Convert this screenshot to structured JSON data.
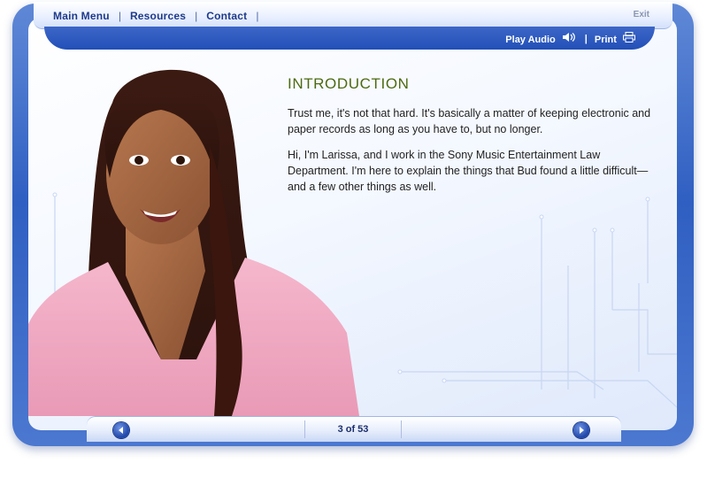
{
  "nav": {
    "main_menu": "Main Menu",
    "resources": "Resources",
    "contact": "Contact",
    "sep": "|",
    "exit": "Exit"
  },
  "tools": {
    "play_audio": "Play Audio",
    "print": "Print",
    "sep": "|"
  },
  "content": {
    "heading": "INTRODUCTION",
    "paragraphs": [
      "Trust me, it's not that hard. It's basically a matter of keeping electronic and paper records as long as you have to, but no longer.",
      "Hi, I'm Larissa, and I work in the Sony Music Entertainment Law Department. I'm here to explain the things that Bud found a little difficult—and a few other things as well."
    ]
  },
  "pager": {
    "text": "3 of 53"
  },
  "colors": {
    "frame": "#2f5fc2",
    "heading": "#4d6a10",
    "nav_text": "#1f3a8a"
  }
}
